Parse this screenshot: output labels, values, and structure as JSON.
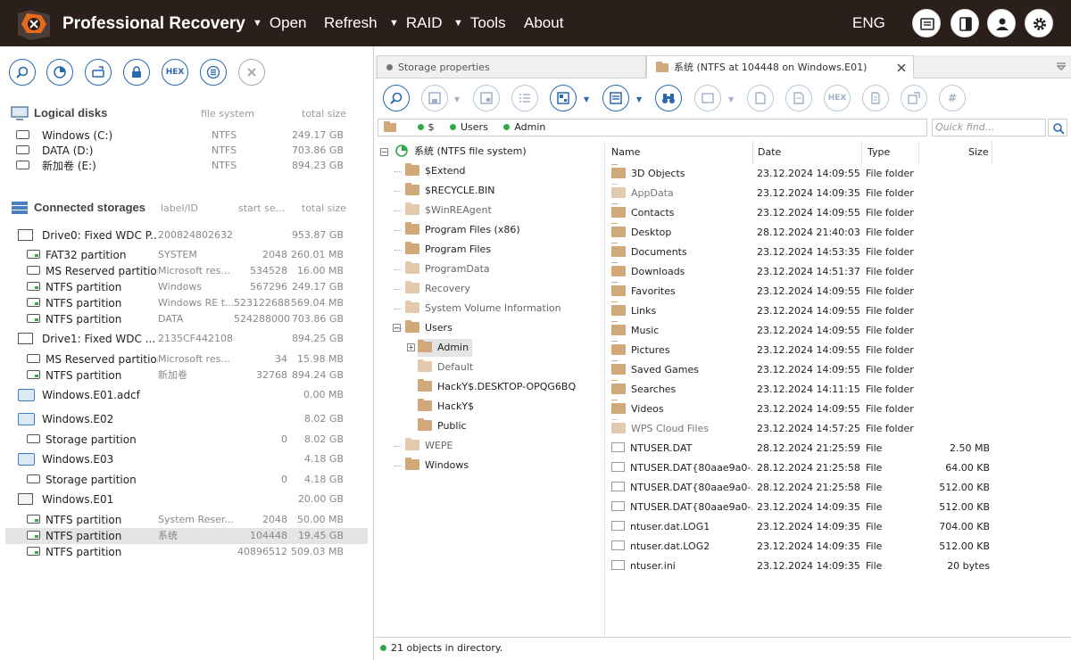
{
  "app": {
    "title": "Professional Recovery",
    "lang": "ENG"
  },
  "menu": {
    "open": "Open",
    "refresh": "Refresh",
    "raid": "RAID",
    "tools": "Tools",
    "about": "About"
  },
  "left": {
    "logical": {
      "title": "Logical disks",
      "col1": "file system",
      "col2": "total size",
      "disks": [
        {
          "name": "Windows (C:)",
          "fs": "NTFS",
          "size": "249.17 GB"
        },
        {
          "name": "DATA (D:)",
          "fs": "NTFS",
          "size": "703.86 GB"
        },
        {
          "name": "新加卷 (E:)",
          "fs": "NTFS",
          "size": "894.23 GB"
        }
      ]
    },
    "storages": {
      "title": "Connected storages",
      "col1": "label/ID",
      "col2": "start se...",
      "col3": "total size",
      "rows": [
        {
          "name": "Drive0: Fixed WDC P...",
          "label": "200824802632",
          "start": "",
          "size": "953.87 GB"
        },
        {
          "name": "FAT32 partition",
          "label": "SYSTEM",
          "start": "2048",
          "size": "260.01 MB"
        },
        {
          "name": "MS Reserved partition",
          "label": "Microsoft res...",
          "start": "534528",
          "size": "16.00 MB"
        },
        {
          "name": "NTFS partition",
          "label": "Windows",
          "start": "567296",
          "size": "249.17 GB"
        },
        {
          "name": "NTFS partition",
          "label": "Windows RE t...",
          "start": "523122688",
          "size": "569.04 MB"
        },
        {
          "name": "NTFS partition",
          "label": "DATA",
          "start": "524288000",
          "size": "703.86 GB"
        },
        {
          "name": "Drive1: Fixed WDC ...",
          "label": "2135CF442108",
          "start": "",
          "size": "894.25 GB"
        },
        {
          "name": "MS Reserved partition",
          "label": "Microsoft res...",
          "start": "34",
          "size": "15.98 MB"
        },
        {
          "name": "NTFS partition",
          "label": "新加卷",
          "start": "32768",
          "size": "894.24 GB"
        },
        {
          "name": "Windows.E01.adcf",
          "label": "",
          "start": "",
          "size": "0.00 MB"
        },
        {
          "name": "Windows.E02",
          "label": "",
          "start": "",
          "size": "8.02 GB"
        },
        {
          "name": "Storage partition",
          "label": "",
          "start": "0",
          "size": "8.02 GB"
        },
        {
          "name": "Windows.E03",
          "label": "",
          "start": "",
          "size": "4.18 GB"
        },
        {
          "name": "Storage partition",
          "label": "",
          "start": "0",
          "size": "4.18 GB"
        },
        {
          "name": "Windows.E01",
          "label": "",
          "start": "",
          "size": "20.00 GB"
        },
        {
          "name": "NTFS partition",
          "label": "System Reser...",
          "start": "2048",
          "size": "50.00 MB"
        },
        {
          "name": "NTFS partition",
          "label": "系统",
          "start": "104448",
          "size": "19.45 GB"
        },
        {
          "name": "NTFS partition",
          "label": "",
          "start": "40896512",
          "size": "509.03 MB"
        }
      ]
    }
  },
  "tabs": {
    "storage": "Storage properties",
    "active": "系统 (NTFS at 104448 on Windows.E01)"
  },
  "path": {
    "root": "$",
    "p1": "Users",
    "p2": "Admin",
    "quick": "Quick find..."
  },
  "tree": {
    "root": "系统 (NTFS file system)",
    "items": [
      "$Extend",
      "$RECYCLE.BIN",
      "$WinREAgent",
      "Program Files (x86)",
      "Program Files",
      "ProgramData",
      "Recovery",
      "System Volume Information",
      "Users"
    ],
    "users": [
      "Admin",
      "Default",
      "HackY$.DESKTOP-OPQG6BQ",
      "HackY$",
      "Public"
    ],
    "after": [
      "WEPE",
      "Windows"
    ]
  },
  "list": {
    "headers": {
      "name": "Name",
      "date": "Date",
      "type": "Type",
      "size": "Size"
    },
    "rows": [
      {
        "name": "3D Objects",
        "date": "23.12.2024 14:09:55",
        "type": "File folder",
        "size": ""
      },
      {
        "name": "AppData",
        "date": "23.12.2024 14:09:35",
        "type": "File folder",
        "size": ""
      },
      {
        "name": "Contacts",
        "date": "23.12.2024 14:09:55",
        "type": "File folder",
        "size": ""
      },
      {
        "name": "Desktop",
        "date": "28.12.2024 21:40:03",
        "type": "File folder",
        "size": ""
      },
      {
        "name": "Documents",
        "date": "23.12.2024 14:53:35",
        "type": "File folder",
        "size": ""
      },
      {
        "name": "Downloads",
        "date": "23.12.2024 14:51:37",
        "type": "File folder",
        "size": ""
      },
      {
        "name": "Favorites",
        "date": "23.12.2024 14:09:55",
        "type": "File folder",
        "size": ""
      },
      {
        "name": "Links",
        "date": "23.12.2024 14:09:55",
        "type": "File folder",
        "size": ""
      },
      {
        "name": "Music",
        "date": "23.12.2024 14:09:55",
        "type": "File folder",
        "size": ""
      },
      {
        "name": "Pictures",
        "date": "23.12.2024 14:09:55",
        "type": "File folder",
        "size": ""
      },
      {
        "name": "Saved Games",
        "date": "23.12.2024 14:09:55",
        "type": "File folder",
        "size": ""
      },
      {
        "name": "Searches",
        "date": "23.12.2024 14:11:15",
        "type": "File folder",
        "size": ""
      },
      {
        "name": "Videos",
        "date": "23.12.2024 14:09:55",
        "type": "File folder",
        "size": ""
      },
      {
        "name": "WPS Cloud Files",
        "date": "23.12.2024 14:57:25",
        "type": "File folder",
        "size": ""
      },
      {
        "name": "NTUSER.DAT",
        "date": "28.12.2024 21:25:59",
        "type": "File",
        "size": "2.50 MB"
      },
      {
        "name": "NTUSER.DAT{80aae9a0-...",
        "date": "28.12.2024 21:25:58",
        "type": "File",
        "size": "64.00 KB"
      },
      {
        "name": "NTUSER.DAT{80aae9a0-...",
        "date": "28.12.2024 21:25:58",
        "type": "File",
        "size": "512.00 KB"
      },
      {
        "name": "NTUSER.DAT{80aae9a0-...",
        "date": "23.12.2024 14:09:35",
        "type": "File",
        "size": "512.00 KB"
      },
      {
        "name": "ntuser.dat.LOG1",
        "date": "23.12.2024 14:09:35",
        "type": "File",
        "size": "704.00 KB"
      },
      {
        "name": "ntuser.dat.LOG2",
        "date": "23.12.2024 14:09:35",
        "type": "File",
        "size": "512.00 KB"
      },
      {
        "name": "ntuser.ini",
        "date": "23.12.2024 14:09:35",
        "type": "File",
        "size": "20 bytes"
      }
    ]
  },
  "status": "21 objects in directory.",
  "icons": {
    "left_toolbar": [
      "search-icon",
      "disk-scan-icon",
      "disk-image-icon",
      "lock-icon",
      "hex-icon",
      "list-icon",
      "close-icon"
    ]
  }
}
